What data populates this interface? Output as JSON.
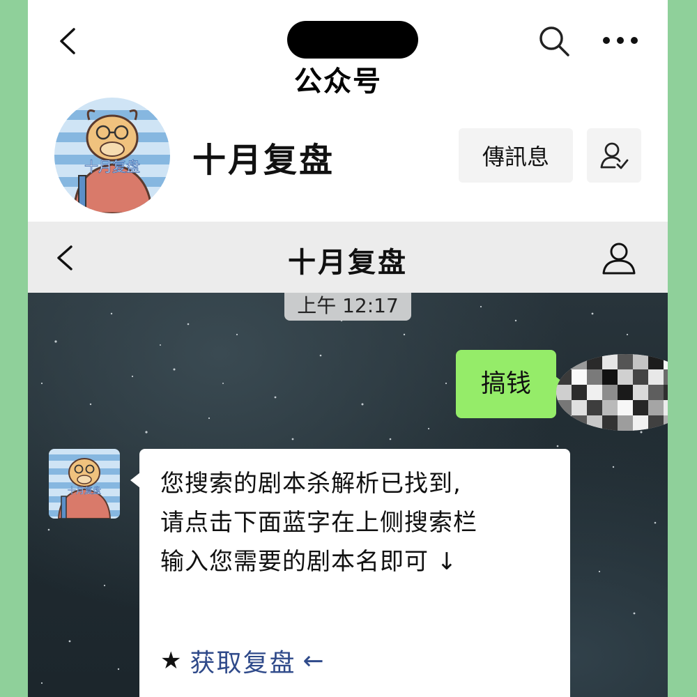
{
  "top_bar": {
    "account_type": "公众号",
    "back_icon": "chevron-left-icon",
    "search_icon": "search-icon",
    "more_icon": "more-dots-icon"
  },
  "profile": {
    "name": "十月复盘",
    "avatar_text": "十月复盘",
    "send_message_label": "傳訊息",
    "follow_icon": "user-check-icon"
  },
  "chat": {
    "title": "十月复盘",
    "timestamp": "上午 12:17",
    "messages": [
      {
        "from": "me",
        "text": "搞钱"
      },
      {
        "from": "account",
        "lines": [
          "您搜索的剧本杀解析已找到,",
          "请点击下面蓝字在上侧搜索栏",
          "输入您需要的剧本名即可 ↓"
        ],
        "star": "★",
        "link_text": "获取复盘",
        "link_arrow": "←"
      }
    ]
  },
  "colors": {
    "my_bubble": "#95ec69",
    "link": "#2f4a8a",
    "side_background": "#8fd09a"
  }
}
